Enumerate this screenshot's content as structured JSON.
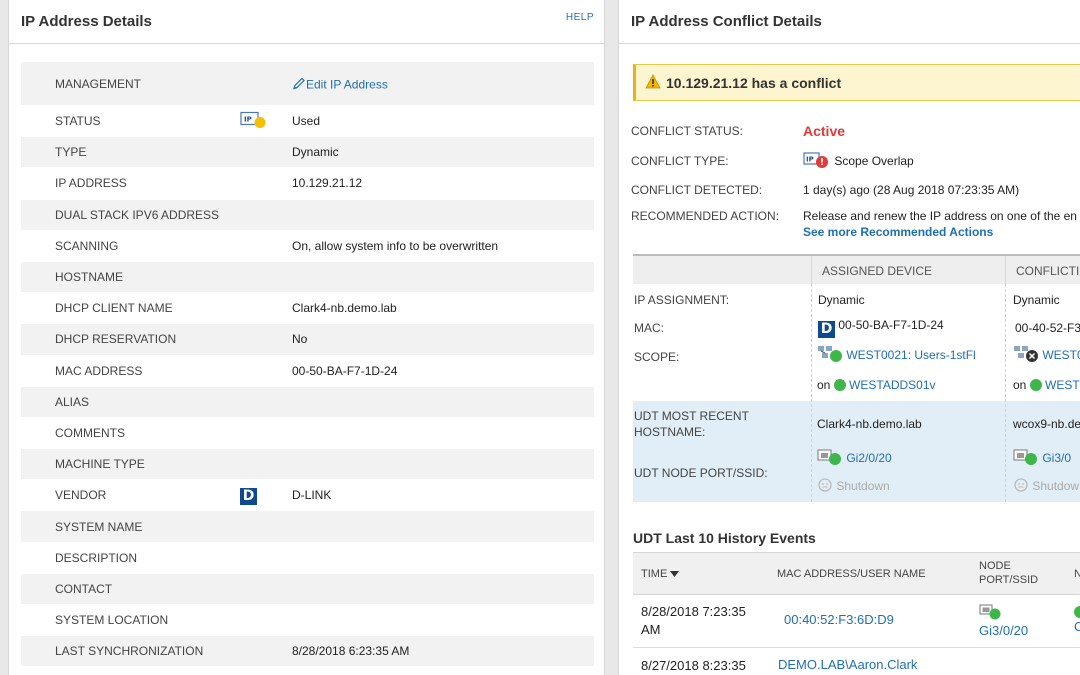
{
  "left_panel": {
    "title": "IP Address Details",
    "help_label": "HELP",
    "edit_label": "Edit IP Address",
    "rows": [
      {
        "label": "MANAGEMENT",
        "value": ""
      },
      {
        "label": "STATUS",
        "value": "Used"
      },
      {
        "label": "TYPE",
        "value": "Dynamic"
      },
      {
        "label": "IP ADDRESS",
        "value": "10.129.21.12"
      },
      {
        "label": "DUAL STACK IPV6 ADDRESS",
        "value": ""
      },
      {
        "label": "SCANNING",
        "value": "On, allow system info to be overwritten"
      },
      {
        "label": "HOSTNAME",
        "value": ""
      },
      {
        "label": "DHCP CLIENT NAME",
        "value": "Clark4-nb.demo.lab"
      },
      {
        "label": "DHCP RESERVATION",
        "value": "No"
      },
      {
        "label": "MAC ADDRESS",
        "value": "00-50-BA-F7-1D-24"
      },
      {
        "label": "ALIAS",
        "value": ""
      },
      {
        "label": "COMMENTS",
        "value": ""
      },
      {
        "label": "MACHINE TYPE",
        "value": ""
      },
      {
        "label": "VENDOR",
        "value": "D-LINK"
      },
      {
        "label": "SYSTEM NAME",
        "value": ""
      },
      {
        "label": "DESCRIPTION",
        "value": ""
      },
      {
        "label": "CONTACT",
        "value": ""
      },
      {
        "label": "SYSTEM LOCATION",
        "value": ""
      },
      {
        "label": "LAST SYNCHRONIZATION",
        "value": "8/28/2018 6:23:35 AM"
      }
    ],
    "status_icon_text": "IP",
    "vendor_logo_text": "D"
  },
  "right_panel": {
    "title": "IP Address Conflict Details",
    "warning": "10.129.21.12 has a conflict",
    "conflict_status_label": "CONFLICT STATUS:",
    "conflict_status_value": "Active",
    "conflict_type_label": "CONFLICT TYPE:",
    "conflict_type_value": "Scope Overlap",
    "conflict_detected_label": "CONFLICT DETECTED:",
    "conflict_detected_value": "1 day(s) ago (28 Aug 2018 07:23:35 AM)",
    "recommended_label": "RECOMMENDED ACTION:",
    "recommended_value": "Release and renew the IP address on one of the en",
    "see_more": "See more Recommended Actions",
    "table": {
      "col_assigned": "ASSIGNED DEVICE",
      "col_conflicting": "CONFLICTING",
      "ip_assignment_label": "IP ASSIGNMENT:",
      "mac_label": "MAC:",
      "scope_label": "SCOPE:",
      "udt_hostname_label_1": "UDT MOST RECENT",
      "udt_hostname_label_2": "HOSTNAME:",
      "udt_port_label": "UDT NODE PORT/SSID:",
      "on_label": "on",
      "assigned": {
        "ip_assignment": "Dynamic",
        "mac": "00-50-BA-F7-1D-24",
        "scope": "WEST0021: Users-1stFl",
        "server": "WESTADDS01v",
        "hostname": "Clark4-nb.demo.lab",
        "port": "Gi2/0/20",
        "port_state": "Shutdown"
      },
      "conflicting": {
        "ip_assignment": "Dynamic",
        "mac": "00-40-52-F3",
        "scope": "WEST0",
        "server": "WEST",
        "hostname": "wcox9-nb.de",
        "port": "Gi3/0",
        "port_state": "Shutdow"
      }
    },
    "history": {
      "title": "UDT Last 10 History Events",
      "col_time": "TIME",
      "col_mac": "MAC ADDRESS/USER NAME",
      "col_node_1": "NODE",
      "col_node_2": "PORT/SSID",
      "col_extra": "N",
      "rows": [
        {
          "time_1": "8/28/2018 7:23:35",
          "time_2": "AM",
          "mac": "00:40:52:F3:6D:D9",
          "port": "Gi3/0/20",
          "extra": "C"
        },
        {
          "time_1": "8/27/2018 8:23:35",
          "time_2": "",
          "mac": "DEMO.LAB\\Aaron.Clark",
          "port": "",
          "extra": ""
        }
      ]
    }
  }
}
